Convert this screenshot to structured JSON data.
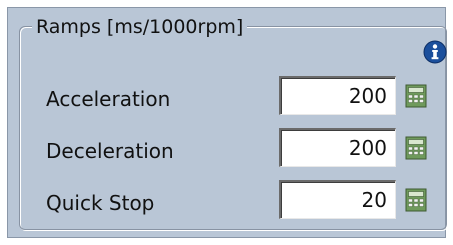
{
  "group": {
    "title": "Ramps [ms/1000rpm]",
    "info_icon": "info-icon"
  },
  "rows": [
    {
      "label": "Acceleration",
      "value": "200",
      "icon": "calculator-icon"
    },
    {
      "label": "Deceleration",
      "value": "200",
      "icon": "calculator-icon"
    },
    {
      "label": "Quick Stop",
      "value": "20",
      "icon": "calculator-icon"
    }
  ],
  "colors": {
    "panel_background": "#b9c6d6",
    "info_icon": "#1b4f9c",
    "calculator_body": "#6f9a5c"
  }
}
